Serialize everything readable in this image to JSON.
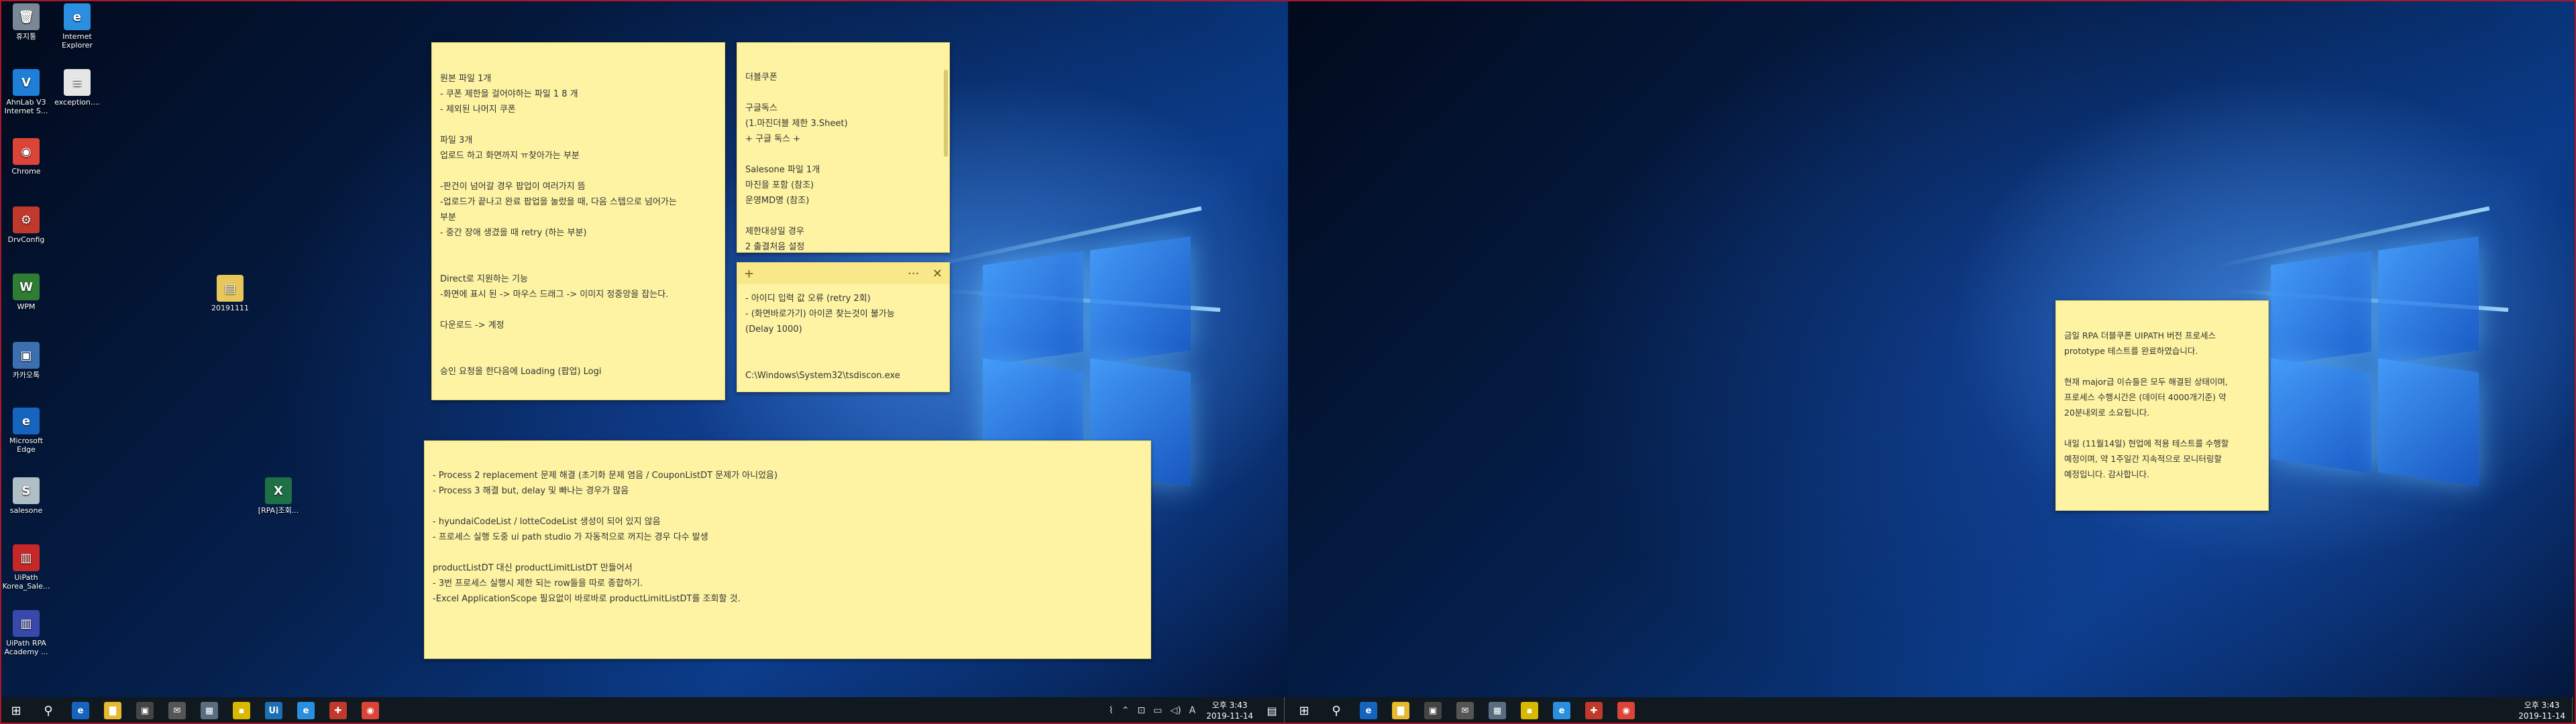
{
  "left_desktop": {
    "icons": [
      {
        "label": "휴지통",
        "icon": "recycle-bin-icon",
        "glyph": "🗑",
        "color": "#7a8896"
      },
      {
        "label": "Internet Explorer",
        "icon": "internet-explorer-icon",
        "glyph": "e",
        "color": "#2a8fe0"
      },
      {
        "label": "AhnLab V3 Internet S...",
        "icon": "ahnlab-v3-icon",
        "glyph": "V",
        "color": "#1f7fd8"
      },
      {
        "label": "exception....",
        "icon": "text-file-icon",
        "glyph": "≡",
        "color": "#e6e6e6"
      },
      {
        "label": "Chrome",
        "icon": "chrome-icon",
        "glyph": "◉",
        "color": "#db4437"
      },
      {
        "label": "DrvConfig",
        "icon": "drvconfig-icon",
        "glyph": "⚙",
        "color": "#c0392b"
      },
      {
        "label": "WPM",
        "icon": "wpm-icon",
        "glyph": "W",
        "color": "#2e7d32"
      },
      {
        "label": "20191111",
        "icon": "folder-zip-icon",
        "glyph": "▤",
        "color": "#e8c65a"
      },
      {
        "label": "카카오톡",
        "icon": "kakaotalk-icon",
        "glyph": "▣",
        "color": "#3c6fb0"
      },
      {
        "label": "Microsoft Edge",
        "icon": "edge-icon",
        "glyph": "e",
        "color": "#1565c0"
      },
      {
        "label": "salesone",
        "icon": "salesone-icon",
        "glyph": "S",
        "color": "#b0bec5"
      },
      {
        "label": "[RPA]조회...",
        "icon": "excel-file-icon",
        "glyph": "X",
        "color": "#1e7145"
      },
      {
        "label": "UiPath Korea_Sale...",
        "icon": "pdf-file-icon",
        "glyph": "▥",
        "color": "#c62828"
      },
      {
        "label": "UiPath RPA Academy ...",
        "icon": "pdf-file-icon",
        "glyph": "▥",
        "color": "#3949ab"
      }
    ],
    "notes": {
      "note1": [
        "원본 파일 1개",
        "- 쿠폰 제한을 걸어야하는 파일 1 8 개",
        "- 제외된 나머지 쿠폰",
        "",
        "파일 3개",
        "업로드 하고 화면까지 ㅠ찾아가는 부분",
        "",
        "-판건이 넘어갈 경우 팝업이 여러가지 뜸",
        "-업로드가 끝나고 완료 팝업을 눌렀을 때, 다음 스텝으로 넘어가는",
        "부분",
        "- 중간 장애 생겼을 때 retry (하는 부분)",
        "",
        "",
        "Direct로 지원하는 기능",
        "-화면에 표시 된 -> 마우스 드래그 -> 이미지 정중앙을 잡는다.",
        "",
        "다운로드 -> 계정",
        "",
        "",
        "승인 요청을 한다음에 Loading (팝업) Logi"
      ],
      "note2": [
        "더블쿠폰",
        "",
        "구글독스",
        "(1.마진더블 제한 3.Sheet)",
        "+ 구글 독스 +",
        "",
        "Salesone 파일 1개",
        "마진을 포함 (참조)",
        "운영MD명 (참조)",
        "",
        "제한대상일 경우",
        "2 출결처음 설정"
      ],
      "note3": [
        "- 아이디 입력 값 오류 (retry 2회)",
        "- (화면바로가기) 아이콘 찾는것이 불가능",
        "(Delay 1000)",
        "",
        "",
        "C:\\Windows\\System32\\tsdiscon.exe"
      ],
      "note3_header": {
        "add": "+",
        "more": "···",
        "close": "✕"
      },
      "note4": [
        "- Process 2 replacement 문제 해결 (초기화 문제 염음 / CouponListDT 문제가 아니었음)",
        "- Process 3 해결 but, delay 및 빠나는 경우가 많음",
        "",
        "- hyundaiCodeList / lotteCodeList 생성이 되어 있지 않음",
        "- 프로세스 실행 도중 ui path studio 가 자동적으로 꺼지는 경우 다수 발생",
        "",
        "productListDT 대신 productLimitListDT 만들어서",
        "- 3번 프로세스 실행시 제한 되는 row들을 따로 종합하기.",
        "-Excel ApplicationScope 필요없이 바로바로 productLimitListDT를 조회할 것."
      ]
    },
    "taskbar": {
      "start": "⊞",
      "search": "⚲",
      "apps": [
        {
          "name": "edge-taskbar-icon",
          "glyph": "e",
          "color": "#1565c0"
        },
        {
          "name": "file-explorer-taskbar-icon",
          "glyph": "▇",
          "color": "#e8b830"
        },
        {
          "name": "store-taskbar-icon",
          "glyph": "▣",
          "color": "#444"
        },
        {
          "name": "mail-taskbar-icon",
          "glyph": "✉",
          "color": "#555"
        },
        {
          "name": "app-taskbar-icon",
          "glyph": "▦",
          "color": "#5a6d80"
        },
        {
          "name": "sticky-notes-taskbar-icon",
          "glyph": "▪",
          "color": "#d9b800"
        },
        {
          "name": "uipath-taskbar-icon",
          "glyph": "Ui",
          "color": "#1b6fb5"
        },
        {
          "name": "ie-taskbar-icon",
          "glyph": "e",
          "color": "#2a8fe0"
        },
        {
          "name": "app2-taskbar-icon",
          "glyph": "✚",
          "color": "#c0392b"
        },
        {
          "name": "chrome-taskbar-icon",
          "glyph": "◉",
          "color": "#db4437"
        }
      ],
      "tray_icons": [
        "⌇",
        "⌃",
        "⊡",
        "▭",
        "◁)",
        "A"
      ],
      "time": "오후 3:43",
      "date": "2019-11-14",
      "notification": "▤"
    }
  },
  "right_desktop": {
    "note": [
      "금일 RPA 더블쿠폰 UIPATH 버전 프로세스",
      "prototype 테스트를 완료하였습니다.",
      "",
      "현재 major급 이슈들은 모두 해결된 상태이며,",
      "프로세스 수행시간은 (데이터 4000개기준) 약",
      "20분내외로 소요됩니다.",
      "",
      "내일 (11월14일) 현업에 적용 테스트를 수행할",
      "예정이며, 약 1주일간 지속적으로 모니터링할",
      "예정입니다. 감사합니다."
    ],
    "taskbar": {
      "start": "⊞",
      "search": "⚲",
      "apps": [
        {
          "name": "edge-taskbar-icon",
          "glyph": "e",
          "color": "#1565c0"
        },
        {
          "name": "file-explorer-taskbar-icon",
          "glyph": "▇",
          "color": "#e8b830"
        },
        {
          "name": "store-taskbar-icon",
          "glyph": "▣",
          "color": "#444"
        },
        {
          "name": "mail-taskbar-icon",
          "glyph": "✉",
          "color": "#555"
        },
        {
          "name": "app-taskbar-icon",
          "glyph": "▦",
          "color": "#5a6d80"
        },
        {
          "name": "sticky-notes-taskbar-icon",
          "glyph": "▪",
          "color": "#d9b800"
        },
        {
          "name": "ie-taskbar-icon",
          "glyph": "e",
          "color": "#2a8fe0"
        },
        {
          "name": "app2-taskbar-icon",
          "glyph": "✚",
          "color": "#c0392b"
        },
        {
          "name": "chrome-taskbar-icon",
          "glyph": "◉",
          "color": "#db4437"
        }
      ],
      "time": "오후 3:43",
      "date": "2019-11-14"
    }
  }
}
